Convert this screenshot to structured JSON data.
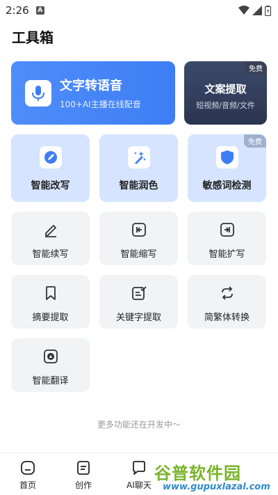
{
  "status_bar": {
    "time": "2:26",
    "notif_letter": "A"
  },
  "page_title": "工具箱",
  "tts": {
    "title": "文字转语音",
    "subtitle": "100+AI主播在线配音"
  },
  "copy_extract": {
    "badge": "免费",
    "title": "文案提取",
    "subtitle": "短视频/音频/文件"
  },
  "blue_tools": [
    {
      "label": "智能改写",
      "icon": "pen-circle-icon"
    },
    {
      "label": "智能润色",
      "icon": "magic-wand-icon"
    },
    {
      "label": "敏感词检测",
      "icon": "shield-icon",
      "badge": "免费"
    }
  ],
  "grey_tools": [
    {
      "label": "智能续写",
      "icon": "pencil-icon"
    },
    {
      "label": "智能缩写",
      "icon": "collapse-icon"
    },
    {
      "label": "智能扩写",
      "icon": "expand-icon"
    },
    {
      "label": "摘要提取",
      "icon": "bookmark-icon"
    },
    {
      "label": "关键字提取",
      "icon": "doc-check-icon"
    },
    {
      "label": "简繁体转换",
      "icon": "convert-icon"
    },
    {
      "label": "智能翻译",
      "icon": "translate-icon"
    }
  ],
  "more_note": "更多功能还在开发中～",
  "bottom_nav": [
    {
      "label": "首页",
      "icon": "home-icon"
    },
    {
      "label": "创作",
      "icon": "create-icon"
    },
    {
      "label": "AI聊天",
      "icon": "chat-icon"
    }
  ],
  "watermark": {
    "title": "谷普软件园",
    "url": "www.gupuxlazal.com"
  },
  "colors": {
    "primary": "#3d7ef5",
    "dark_card": "#2b3550",
    "blue_card": "#d6e4ff",
    "grey_card": "#f2f3f5"
  }
}
